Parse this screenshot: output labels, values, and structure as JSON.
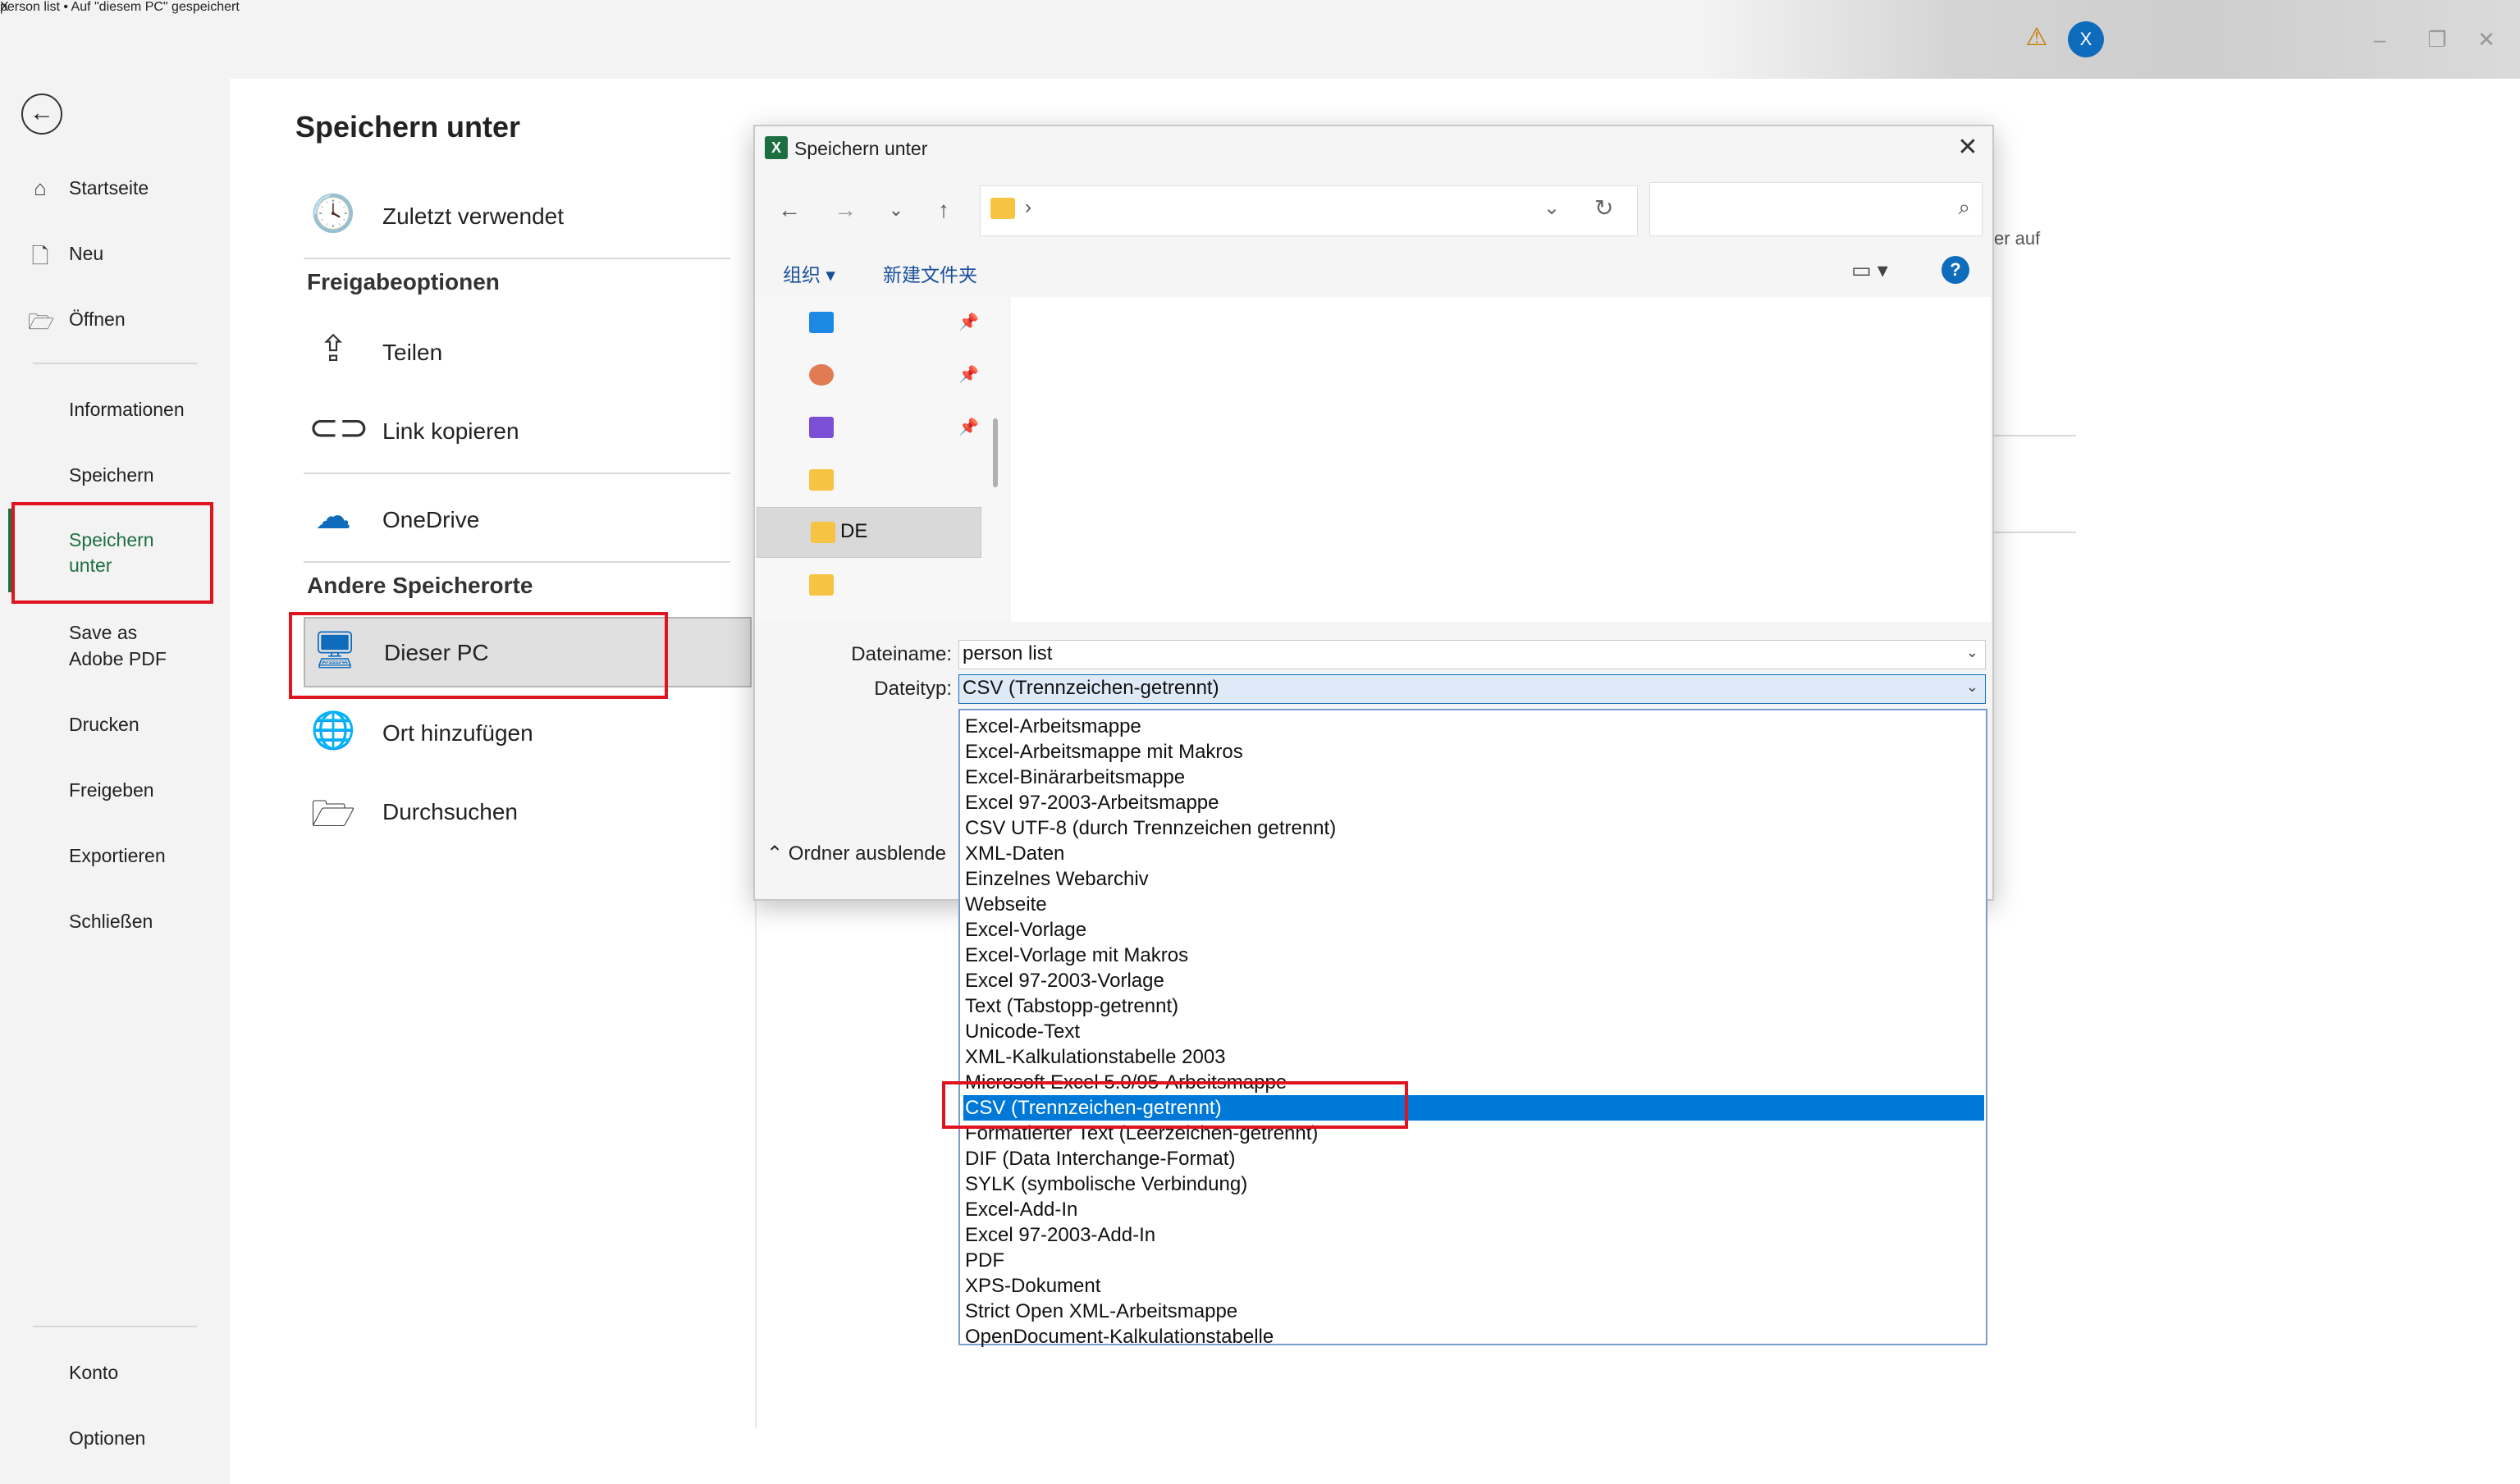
{
  "titlebar": {
    "app_icon": "X",
    "doc_title": "person list  •  Auf \"diesem PC\" gespeichert",
    "avatar": "X"
  },
  "leftnav": {
    "home": "Startseite",
    "new": "Neu",
    "open": "Öffnen",
    "info": "Informationen",
    "save": "Speichern",
    "save_as_1": "Speichern",
    "save_as_2": "unter",
    "save_pdf_1": "Save as",
    "save_pdf_2": "Adobe PDF",
    "print": "Drucken",
    "share": "Freigeben",
    "export": "Exportieren",
    "close": "Schließen",
    "account": "Konto",
    "options": "Optionen"
  },
  "middle": {
    "heading": "Speichern unter",
    "recent": "Zuletzt verwendet",
    "share_section": "Freigabeoptionen",
    "share": "Teilen",
    "copy_link": "Link kopieren",
    "onedrive": "OneDrive",
    "other_section": "Andere Speicherorte",
    "this_pc": "Dieser PC",
    "add_place": "Ort hinzufügen",
    "browse": "Durchsuchen"
  },
  "background": {
    "partial_text": "er auf"
  },
  "dialog": {
    "title": "Speichern unter",
    "toolbar_organize": "组织 ▾",
    "toolbar_new_folder": "新建文件夹",
    "tree_selected": "DE",
    "filename_label": "Dateiname:",
    "filename_value": "person list",
    "filetype_label": "Dateityp:",
    "filetype_value": "CSV (Trennzeichen-getrennt)",
    "hide_folders": "Ordner ausblende",
    "filetypes": [
      "Excel-Arbeitsmappe",
      "Excel-Arbeitsmappe mit Makros",
      "Excel-Binärarbeitsmappe",
      "Excel 97-2003-Arbeitsmappe",
      "CSV UTF-8 (durch Trennzeichen getrennt)",
      "XML-Daten",
      "Einzelnes Webarchiv",
      "Webseite",
      "Excel-Vorlage",
      "Excel-Vorlage mit Makros",
      "Excel 97-2003-Vorlage",
      "Text (Tabstopp-getrennt)",
      "Unicode-Text",
      "XML-Kalkulationstabelle 2003",
      "Microsoft Excel 5.0/95-Arbeitsmappe",
      "CSV (Trennzeichen-getrennt)",
      "Formatierter Text (Leerzeichen-getrennt)",
      "DIF (Data Interchange-Format)",
      "SYLK (symbolische Verbindung)",
      "Excel-Add-In",
      "Excel 97-2003-Add-In",
      "PDF",
      "XPS-Dokument",
      "Strict Open XML-Arbeitsmappe",
      "OpenDocument-Kalkulationstabelle"
    ],
    "selected_index": 15
  },
  "colors": {
    "accent": "#1d6f42",
    "highlight": "#0078d7",
    "annotation": "#e0141e"
  }
}
